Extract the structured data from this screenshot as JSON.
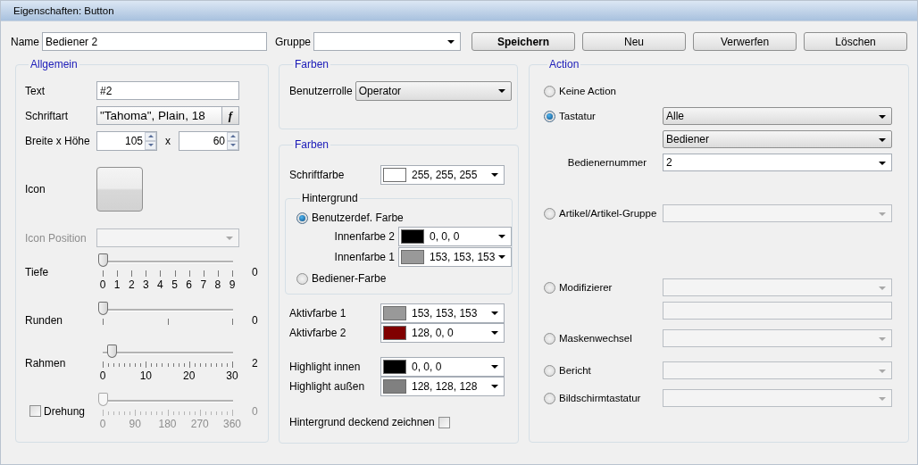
{
  "window": {
    "title": "Eigenschaften: Button"
  },
  "header": {
    "name_label": "Name",
    "name_value": "Bediener 2",
    "group_label": "Gruppe"
  },
  "buttons": [
    {
      "label": "Speichern",
      "default": true
    },
    {
      "label": "Neu",
      "default": false
    },
    {
      "label": "Verwerfen",
      "default": false
    },
    {
      "label": "Löschen",
      "default": false
    }
  ],
  "general": {
    "title": "Allgemein",
    "text_label": "Text",
    "text_value": "#2",
    "font_label": "Schriftart",
    "font_value": "\"Tahoma\", Plain, 18",
    "font_button": "f",
    "size_label": "Breite x Höhe",
    "width_value": "105",
    "size_separator": "x",
    "height_value": "60",
    "icon_label": "Icon",
    "icon_position": {
      "label": "Icon Position",
      "disabled": true
    },
    "sliders": [
      {
        "label": "Tiefe",
        "value": "0",
        "level": 0,
        "kind": "each",
        "tick_labels": [
          "0",
          "1",
          "2",
          "3",
          "4",
          "5",
          "6",
          "7",
          "8",
          "9"
        ],
        "disabled": false
      },
      {
        "label": "Runden",
        "value": "0",
        "level": 0,
        "kind": "sparse",
        "disabled": false
      },
      {
        "label": "Rahmen",
        "value": "2",
        "level": 0.067,
        "kind": "fine",
        "tick_labels": [
          "0",
          "10",
          "20",
          "30"
        ],
        "disabled": false
      },
      {
        "label": "Drehung",
        "value": "0",
        "level": 0,
        "kind": "fine",
        "tick_labels": [
          "0",
          "90",
          "180",
          "270",
          "360"
        ],
        "disabled": true,
        "checked": false
      }
    ]
  },
  "role_panel": {
    "title": "Farben",
    "label": "Benutzerrolle",
    "value": "Operator"
  },
  "colors_panel": {
    "title": "Farben",
    "font_color": {
      "label": "Schriftfarbe",
      "value": "255, 255, 255",
      "color": "#ffffff"
    },
    "background": {
      "title": "Hintergrund",
      "options": [
        {
          "label": "Benutzerdef. Farbe",
          "selected": true,
          "colors": [
            {
              "label": "Innenfarbe 2",
              "value": "0, 0, 0",
              "color": "#000000"
            },
            {
              "label": "Innenfarbe 1",
              "value": "153, 153, 153",
              "color": "#999999"
            }
          ]
        },
        {
          "label": "Bediener-Farbe",
          "selected": false
        }
      ]
    },
    "active_colors": [
      {
        "label": "Aktivfarbe 1",
        "value": "153, 153, 153",
        "color": "#999999"
      },
      {
        "label": "Aktivfarbe 2",
        "value": "128, 0, 0",
        "color": "#800000"
      }
    ],
    "highlight_colors": [
      {
        "label": "Highlight innen",
        "value": "0, 0, 0",
        "color": "#000000"
      },
      {
        "label": "Highlight außen",
        "value": "128, 128, 128",
        "color": "#808080"
      }
    ],
    "opaque": {
      "label": "Hintergrund deckend zeichnen",
      "checked": false
    }
  },
  "action": {
    "title": "Action",
    "options": [
      {
        "label": "Keine Action",
        "selected": false
      },
      {
        "label": "Tastatur",
        "selected": true,
        "fields": [
          {
            "kind": "select",
            "value": "Alle",
            "disabled": false
          },
          {
            "kind": "select",
            "value": "Bediener",
            "disabled": false
          },
          {
            "kind": "combo",
            "label": "Bedienernummer",
            "value": "2",
            "disabled": false
          }
        ]
      },
      {
        "label": "Artikel/Artikel-Gruppe",
        "selected": false,
        "fields": [
          {
            "kind": "combo",
            "disabled": true
          }
        ]
      },
      {
        "label": "Modifizierer",
        "selected": false,
        "fields": [
          {
            "kind": "combo",
            "disabled": true
          },
          {
            "kind": "text",
            "disabled": true
          }
        ]
      },
      {
        "label": "Maskenwechsel",
        "selected": false,
        "fields": [
          {
            "kind": "combo",
            "disabled": true
          }
        ]
      },
      {
        "label": "Bericht",
        "selected": false,
        "fields": [
          {
            "kind": "combo",
            "disabled": true
          }
        ]
      },
      {
        "label": "Bildschirmtastatur",
        "selected": false,
        "fields": [
          {
            "kind": "combo",
            "disabled": true
          }
        ]
      }
    ]
  }
}
